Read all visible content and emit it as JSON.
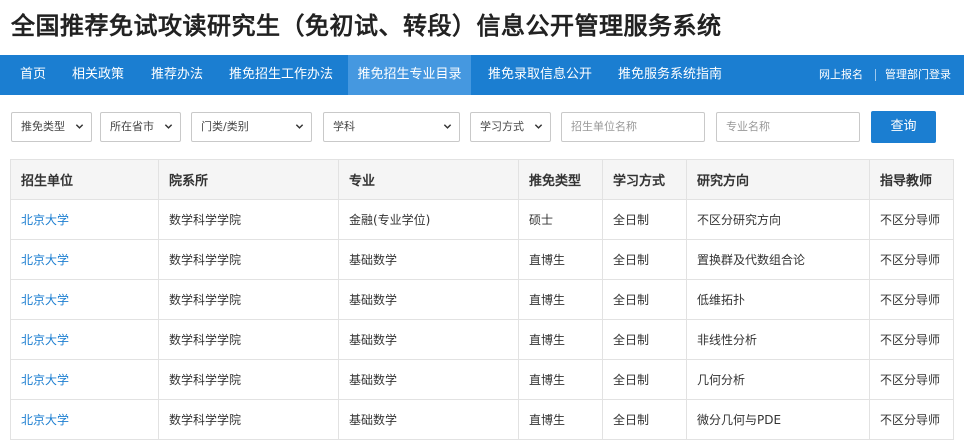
{
  "page_title": "全国推荐免试攻读研究生（免初试、转段）信息公开管理服务系统",
  "nav": {
    "items": [
      {
        "label": "首页"
      },
      {
        "label": "相关政策"
      },
      {
        "label": "推荐办法"
      },
      {
        "label": "推免招生工作办法"
      },
      {
        "label": "推免招生专业目录"
      },
      {
        "label": "推免录取信息公开"
      },
      {
        "label": "推免服务系统指南"
      }
    ],
    "active_index": 4,
    "online_register": "网上报名",
    "admin_login": "管理部门登录"
  },
  "filters": {
    "type": "推免类型",
    "province": "所在省市",
    "category": "门类/类别",
    "subject": "学科",
    "study_mode": "学习方式",
    "unit_placeholder": "招生单位名称",
    "major_placeholder": "专业名称",
    "query_label": "查询"
  },
  "table": {
    "headers": [
      "招生单位",
      "院系所",
      "专业",
      "推免类型",
      "学习方式",
      "研究方向",
      "指导教师"
    ],
    "rows": [
      [
        "北京大学",
        "数学科学学院",
        "金融(专业学位)",
        "硕士",
        "全日制",
        "不区分研究方向",
        "不区分导师"
      ],
      [
        "北京大学",
        "数学科学学院",
        "基础数学",
        "直博生",
        "全日制",
        "置换群及代数组合论",
        "不区分导师"
      ],
      [
        "北京大学",
        "数学科学学院",
        "基础数学",
        "直博生",
        "全日制",
        "低维拓扑",
        "不区分导师"
      ],
      [
        "北京大学",
        "数学科学学院",
        "基础数学",
        "直博生",
        "全日制",
        "非线性分析",
        "不区分导师"
      ],
      [
        "北京大学",
        "数学科学学院",
        "基础数学",
        "直博生",
        "全日制",
        "几何分析",
        "不区分导师"
      ],
      [
        "北京大学",
        "数学科学学院",
        "基础数学",
        "直博生",
        "全日制",
        "微分几何与PDE",
        "不区分导师"
      ]
    ]
  },
  "colors": {
    "nav_bg": "#1b7ed1",
    "nav_active_bg": "#4598e0",
    "link": "#1b7ed1",
    "header_bg": "#f5f5f5"
  }
}
